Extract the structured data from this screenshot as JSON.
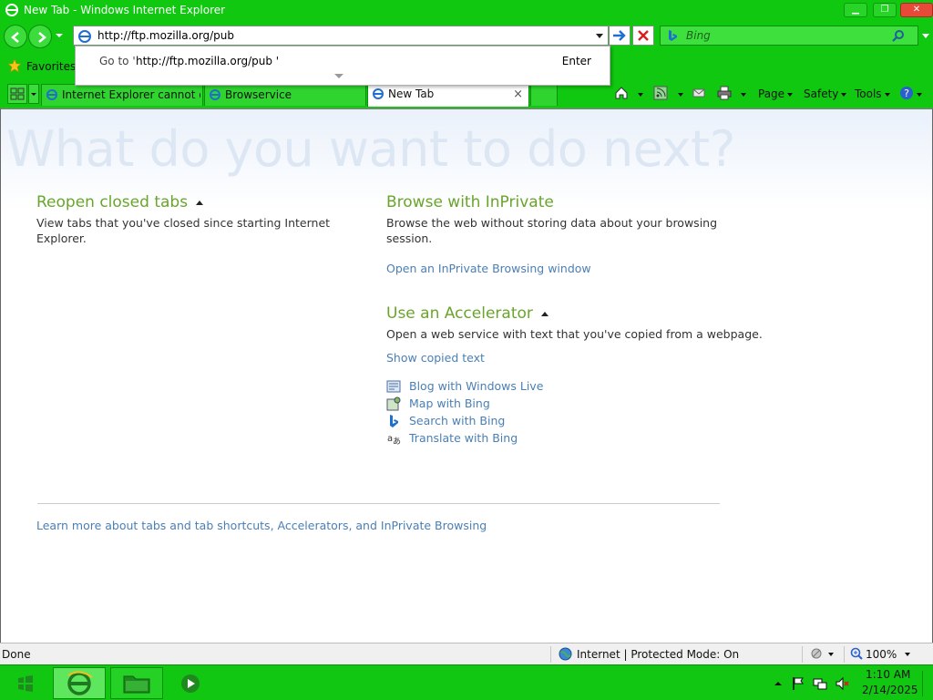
{
  "window": {
    "title": "New Tab - Windows Internet Explorer"
  },
  "address": {
    "url": "http://ftp.mozilla.org/pub"
  },
  "search": {
    "placeholder": "Bing"
  },
  "autocomplete": {
    "goto_prefix": "Go to '",
    "goto_url": "http://ftp.mozilla.org/pub '",
    "enter_label": "Enter"
  },
  "favorites": {
    "label": "Favorites"
  },
  "tabs": [
    {
      "label": "Internet Explorer cannot di..."
    },
    {
      "label": "Browservice"
    },
    {
      "label": "New Tab",
      "close": "×"
    }
  ],
  "commandbar": {
    "page": "Page",
    "safety": "Safety",
    "tools": "Tools"
  },
  "content": {
    "heading": "What do you want to do next?",
    "reopen": {
      "title": "Reopen closed tabs",
      "desc": "View tabs that you've closed since starting Internet Explorer."
    },
    "inprivate": {
      "title": "Browse with InPrivate",
      "desc": "Browse the web without storing data about your browsing session.",
      "link": "Open an InPrivate Browsing window"
    },
    "accelerator": {
      "title": "Use an Accelerator",
      "desc": "Open a web service with text that you've copied from a webpage.",
      "show_link": "Show copied text",
      "items": [
        {
          "label": "Blog with Windows Live",
          "icon": "blog-icon"
        },
        {
          "label": "Map with Bing",
          "icon": "map-icon"
        },
        {
          "label": "Search with Bing",
          "icon": "bing-icon"
        },
        {
          "label": "Translate with Bing",
          "icon": "translate-icon"
        }
      ]
    },
    "learn_more": "Learn more about tabs and tab shortcuts, Accelerators, and InPrivate Browsing"
  },
  "status": {
    "text": "Done",
    "zone": "Internet | Protected Mode: On",
    "zoom": "100%"
  },
  "clock": {
    "time": "1:10 AM",
    "date": "2/14/2025"
  },
  "colors": {
    "chrome_green": "#10c810",
    "section_title": "#6aa52b",
    "link": "#4a7fb5"
  }
}
